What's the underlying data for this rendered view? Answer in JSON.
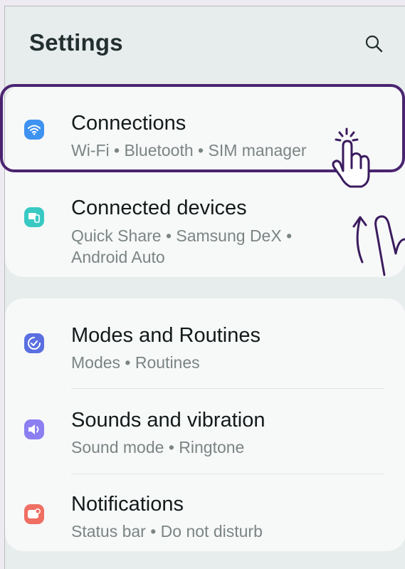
{
  "header": {
    "title": "Settings"
  },
  "icons": {
    "search": "search-icon"
  },
  "colors": {
    "connections_icon": "#3e92f0",
    "connected_devices_icon": "#39c9c3",
    "modes_icon": "#5a6fe0",
    "sounds_icon": "#8b7ff2",
    "notifications_icon": "#ef6f62",
    "highlight": "#4a2470"
  },
  "groups": [
    {
      "items": [
        {
          "title": "Connections",
          "subtitle": "Wi-Fi  •  Bluetooth  •  SIM manager",
          "icon": "wifi-icon"
        },
        {
          "title": "Connected devices",
          "subtitle": "Quick Share  •  Samsung DeX  •",
          "subtitle2": "Android Auto",
          "icon": "devices-icon"
        }
      ]
    },
    {
      "items": [
        {
          "title": "Modes and Routines",
          "subtitle": "Modes  •  Routines",
          "icon": "check-circle-icon"
        },
        {
          "title": "Sounds and vibration",
          "subtitle": "Sound mode  •  Ringtone",
          "icon": "volume-icon"
        },
        {
          "title": "Notifications",
          "subtitle": "Status bar  •  Do not disturb",
          "icon": "notification-icon"
        }
      ]
    }
  ],
  "annotations": {
    "tap_gesture": "tap-hand-icon",
    "swipe_up_gesture": "swipe-up-hand-icon"
  }
}
